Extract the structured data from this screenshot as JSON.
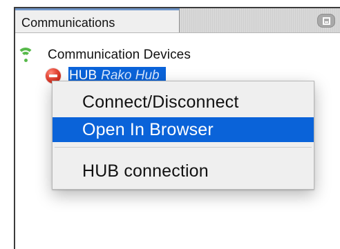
{
  "panel": {
    "tab_title": "Communications"
  },
  "tree": {
    "root_label": "Communication Devices",
    "child_name": "HUB",
    "child_description": "Rako Hub"
  },
  "context_menu": {
    "items": [
      {
        "label": "Connect/Disconnect",
        "highlighted": false
      },
      {
        "label": "Open In Browser",
        "highlighted": true
      },
      {
        "label": "HUB connection",
        "highlighted": false
      }
    ]
  },
  "icons": {
    "minimize": "minimize-icon",
    "network": "wifi-icon",
    "status": "disconnected-icon"
  },
  "colors": {
    "accent": "#0a63d9",
    "network_green": "#57b94b",
    "status_red": "#d9362b"
  }
}
